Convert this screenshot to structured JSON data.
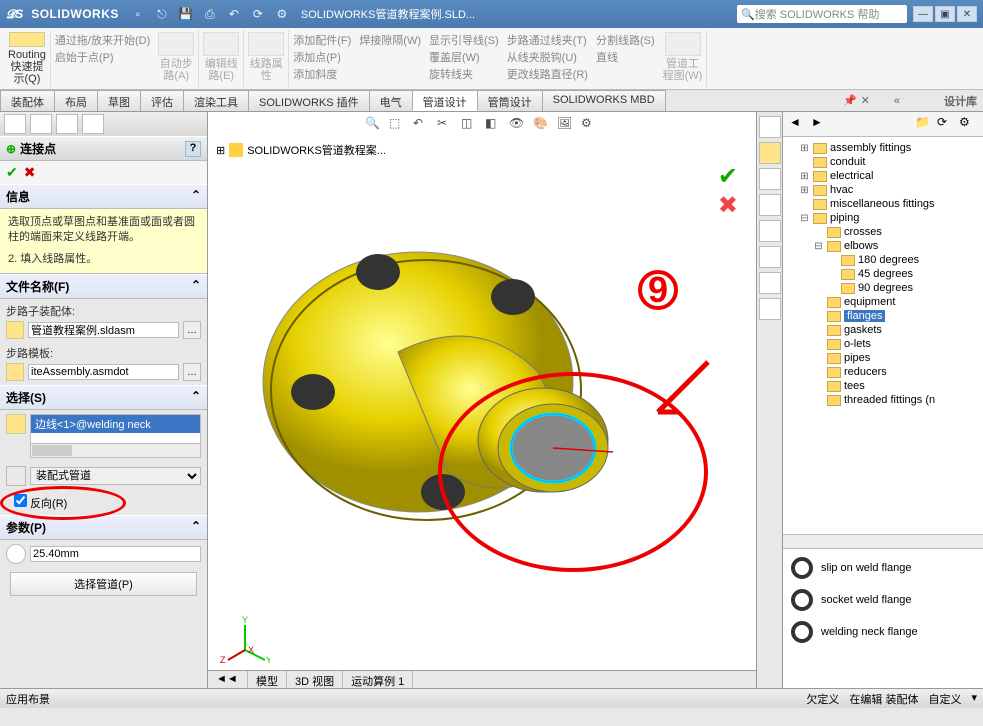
{
  "app": {
    "name": "SOLIDWORKS",
    "title_doc": "SOLIDWORKS管道教程案例.SLD...",
    "search_placeholder": "搜索 SOLIDWORKS 帮助"
  },
  "ribbon": {
    "routing_group": "Routing\n快速提\n示(Q)",
    "cmds_left": [
      "通过拖/放来开始(D)",
      "启始于点(P)"
    ],
    "autoroute": "自动步\n路(A)",
    "editroute": "编辑线\n路(E)",
    "routeprops": "线路属\n性",
    "cmds_mid": [
      "添加配件(F)",
      "添加点(P)",
      "添加斜度"
    ],
    "weld": "焊接隙隔(W)",
    "cmds_r1": [
      "显示引导线(S)",
      "覆盖层(W)",
      "旋转线夹"
    ],
    "cmds_r2": [
      "步路通过线夹(T)",
      "从线夹脱钩(U)",
      "更改线路直径(R)"
    ],
    "cmds_r3": [
      "分割线路(S)",
      "直线"
    ],
    "pipetool": "管道工\n程图(W)"
  },
  "tabs": [
    "装配体",
    "布局",
    "草图",
    "评估",
    "渲染工具",
    "SOLIDWORKS 插件",
    "电气",
    "管道设计",
    "管筒设计",
    "SOLIDWORKS MBD"
  ],
  "active_tab": 7,
  "taskpane_title": "设计库",
  "left": {
    "feature_title": "连接点",
    "info_title": "信息",
    "info_text1": "选取顶点或草图点和基准面或面或者圆柱的端面来定义线路开端。",
    "info_text2": "2. 填入线路属性。",
    "file_title": "文件名称(F)",
    "file_label1": "步路子装配体:",
    "file_value1": "管道教程案例.sldasm",
    "file_label2": "步路模板:",
    "file_value2": "iteAssembly.asmdot",
    "select_title": "选择(S)",
    "select_item": "边线<1>@welding neck",
    "combo_value": "装配式管道",
    "check_label": "反向(R)",
    "param_title": "参数(P)",
    "param_value": "25.40mm",
    "btn_pipe": "选择管道(P)"
  },
  "viewport": {
    "tree_label": "SOLIDWORKS管道教程案...",
    "vtabs": [
      "模型",
      "3D 视图",
      "运动算例 1"
    ]
  },
  "taskpane": {
    "tree": [
      {
        "level": 1,
        "expander": "+",
        "label": "assembly fittings"
      },
      {
        "level": 1,
        "expander": "",
        "label": "conduit"
      },
      {
        "level": 1,
        "expander": "+",
        "label": "electrical"
      },
      {
        "level": 1,
        "expander": "+",
        "label": "hvac"
      },
      {
        "level": 1,
        "expander": "",
        "label": "miscellaneous fittings"
      },
      {
        "level": 1,
        "expander": "-",
        "label": "piping"
      },
      {
        "level": 2,
        "expander": "",
        "label": "crosses"
      },
      {
        "level": 2,
        "expander": "-",
        "label": "elbows"
      },
      {
        "level": 3,
        "expander": "",
        "label": "180 degrees"
      },
      {
        "level": 3,
        "expander": "",
        "label": "45 degrees"
      },
      {
        "level": 3,
        "expander": "",
        "label": "90 degrees"
      },
      {
        "level": 2,
        "expander": "",
        "label": "equipment"
      },
      {
        "level": 2,
        "expander": "",
        "label": "flanges",
        "selected": true
      },
      {
        "level": 2,
        "expander": "",
        "label": "gaskets"
      },
      {
        "level": 2,
        "expander": "",
        "label": "o-lets"
      },
      {
        "level": 2,
        "expander": "",
        "label": "pipes"
      },
      {
        "level": 2,
        "expander": "",
        "label": "reducers"
      },
      {
        "level": 2,
        "expander": "",
        "label": "tees"
      },
      {
        "level": 2,
        "expander": "",
        "label": "threaded fittings (n"
      }
    ],
    "preview": [
      "slip on weld flange",
      "socket weld flange",
      "welding neck flange"
    ]
  },
  "statusbar": {
    "left": "应用布景",
    "right": [
      "欠定义",
      "在编辑 装配体",
      "自定义"
    ]
  },
  "annotation_number": "9"
}
